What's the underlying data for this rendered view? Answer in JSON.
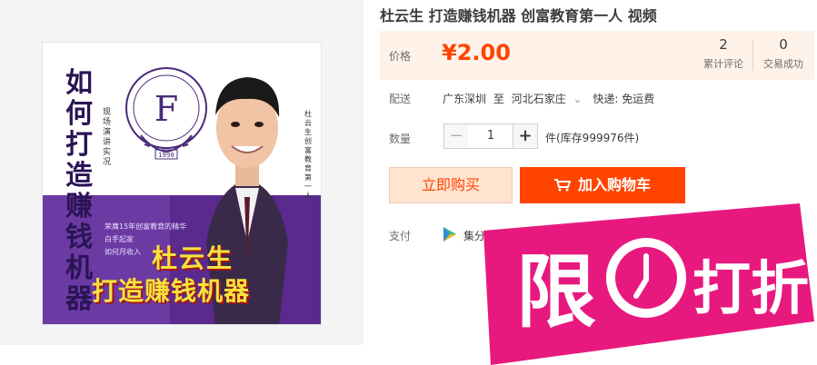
{
  "product": {
    "title": "杜云生 打造赚钱机器 创富教育第一人 视频",
    "cover": {
      "vertical_title": [
        "如",
        "何",
        "打",
        "造",
        "赚",
        "钱",
        "机",
        "器"
      ],
      "sub_left": [
        "现",
        "场",
        "演",
        "讲",
        "实",
        "况"
      ],
      "sub_right": [
        "杜",
        "云",
        "生",
        "创",
        "富",
        "教",
        "育",
        "第",
        "一",
        "人"
      ],
      "seal_text": "FORTUNE EDUCATION",
      "seal_letter": "F",
      "seal_year": "1998",
      "blurb": [
        "荣膺15年创富教育的精华",
        "白手起家",
        "如何月收入"
      ],
      "name": "杜云生",
      "subtitle": "打造赚钱机器"
    }
  },
  "price": {
    "label": "价格",
    "value": "¥2.00"
  },
  "stats": {
    "reviews": {
      "num": "2",
      "label": "累计评论"
    },
    "sales": {
      "num": "0",
      "label": "交易成功"
    }
  },
  "shipping": {
    "label": "配送",
    "from": "广东深圳",
    "to_word": "至",
    "to": "河北石家庄",
    "chevron": "⌄",
    "method": "快递: 免运费"
  },
  "quantity": {
    "label": "数量",
    "minus": "−",
    "value": "1",
    "plus": "+",
    "stock": "件(库存999976件)"
  },
  "actions": {
    "buy_now": "立即购买",
    "add_cart": "加入购物车"
  },
  "payment": {
    "label": "支付",
    "method": "集分宝"
  },
  "badge": {
    "text1": "限",
    "text2": "打折",
    "color": "#e8197e"
  },
  "colors": {
    "accent": "#ff4400",
    "price_bg": "#fff2e8"
  }
}
